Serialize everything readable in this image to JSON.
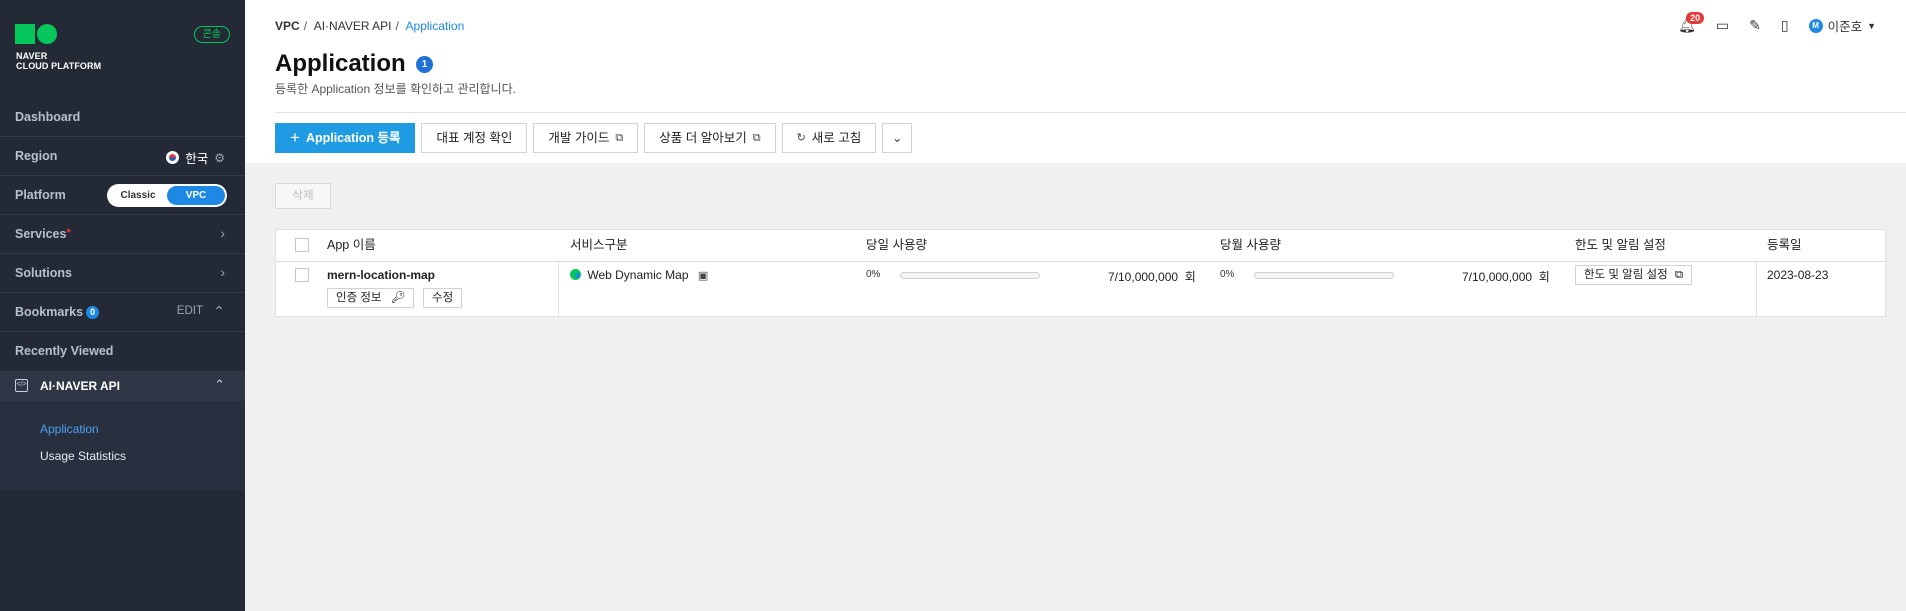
{
  "sidebar": {
    "logo_line1": "NAVER",
    "logo_line2": "CLOUD PLATFORM",
    "console_badge": "콘솔",
    "dashboard": "Dashboard",
    "region_label": "Region",
    "region_value": "한국",
    "platform_label": "Platform",
    "platform_options": [
      "Classic",
      "VPC"
    ],
    "platform_selected": "VPC",
    "services": "Services",
    "solutions": "Solutions",
    "bookmarks": "Bookmarks",
    "bookmarks_count": "0",
    "bookmarks_edit": "EDIT",
    "recently_viewed": "Recently Viewed",
    "active_section": "AI·NAVER API",
    "submenu": [
      {
        "label": "Application",
        "active": true
      },
      {
        "label": "Usage Statistics",
        "active": false
      }
    ]
  },
  "header": {
    "breadcrumb": [
      "VPC",
      "AI·NAVER API",
      "Application"
    ],
    "notifications": "20",
    "user_initial": "M",
    "user_name": "이준호"
  },
  "page": {
    "title": "Application",
    "count": "1",
    "subtitle": "등록한 Application 정보를 확인하고 관리합니다."
  },
  "toolbar": {
    "register": "Application 등록",
    "check_account": "대표 계정 확인",
    "dev_guide": "개발 가이드",
    "learn_more": "상품 더 알아보기",
    "refresh": "새로 고침"
  },
  "actions": {
    "delete": "삭제"
  },
  "table": {
    "columns": [
      "App 이름",
      "서비스구분",
      "당일 사용량",
      "당월 사용량",
      "한도 및 알림 설정",
      "등록일"
    ],
    "rows": [
      {
        "app_name": "mern-location-map",
        "auth_info": "인증 정보",
        "edit": "수정",
        "service": "Web Dynamic Map",
        "daily_pct": "0%",
        "daily_pct_value": 0,
        "daily_usage": "7/10,000,000",
        "daily_unit": "회",
        "monthly_pct": "0%",
        "monthly_pct_value": 0,
        "monthly_usage": "7/10,000,000",
        "monthly_unit": "회",
        "limit_settings": "한도 및 알림 설정",
        "registered": "2023-08-23"
      }
    ]
  }
}
